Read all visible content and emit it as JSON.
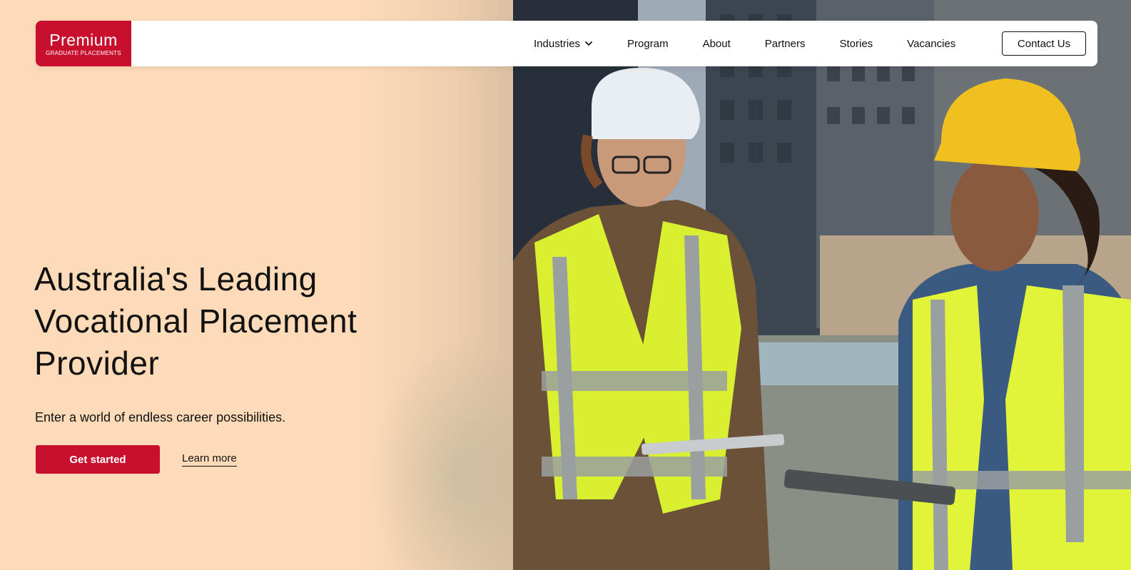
{
  "brand": {
    "name": "Premium",
    "tagline": "GRADUATE PLACEMENTS",
    "color": "#c8102e"
  },
  "nav": {
    "items": [
      {
        "label": "Industries",
        "icon": "chevron-down-icon"
      },
      {
        "label": "Program"
      },
      {
        "label": "About"
      },
      {
        "label": "Partners"
      },
      {
        "label": "Stories"
      },
      {
        "label": "Vacancies"
      }
    ],
    "contact_label": "Contact Us"
  },
  "hero": {
    "title": "Australia's Leading Vocational Placement Provider",
    "subtitle": "Enter a world of endless career possibilities.",
    "primary_cta": "Get started",
    "secondary_cta": "Learn more",
    "background_color": "#fddbb8"
  }
}
